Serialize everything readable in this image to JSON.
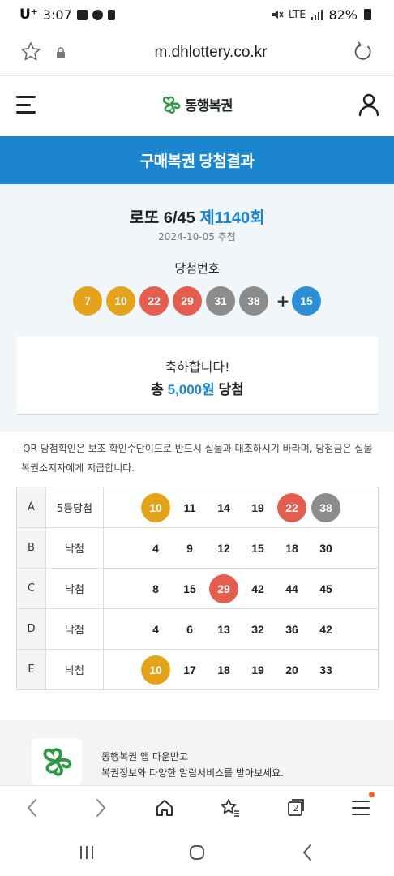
{
  "status_bar": {
    "carrier": "U⁺",
    "time": "3:07",
    "network": "LTE",
    "battery": "82%"
  },
  "browser": {
    "url": "m.dhlottery.co.kr",
    "tabs_count": "2"
  },
  "site": {
    "logo_text": "동행복권",
    "page_title": "구매복권 당첨결과"
  },
  "draw": {
    "game": "로또 6/45",
    "round": "제1140회",
    "date": "2024-10-05 추첨",
    "winning_label": "당첨번호",
    "numbers": [
      7,
      10,
      22,
      29,
      31,
      38
    ],
    "bonus": 15,
    "ball_colors": {
      "7": "#e5a31c",
      "10": "#e5a31c",
      "22": "#e45d4f",
      "29": "#e45d4f",
      "31": "#8c8c8c",
      "38": "#8c8c8c",
      "15": "#2a8fd6"
    }
  },
  "result": {
    "congrats": "축하합니다!",
    "total_prefix": "총",
    "total_amount": "5,000원",
    "total_suffix": "당첨"
  },
  "notice": {
    "line1": "- QR 당첨확인은 보조 확인수단이므로 반드시 실물과 대조하시기 바라며, 당첨금은 실물",
    "line2": "복권소지자에게 지급합니다."
  },
  "tickets": [
    {
      "letter": "A",
      "status": "5등당첨",
      "numbers": [
        "10",
        "11",
        "14",
        "19",
        "22",
        "38"
      ],
      "hits": [
        true,
        false,
        false,
        false,
        true,
        true
      ]
    },
    {
      "letter": "B",
      "status": "낙첨",
      "numbers": [
        "4",
        "9",
        "12",
        "15",
        "18",
        "30"
      ],
      "hits": [
        false,
        false,
        false,
        false,
        false,
        false
      ]
    },
    {
      "letter": "C",
      "status": "낙첨",
      "numbers": [
        "8",
        "15",
        "29",
        "42",
        "44",
        "45"
      ],
      "hits": [
        false,
        false,
        true,
        false,
        false,
        false
      ]
    },
    {
      "letter": "D",
      "status": "낙첨",
      "numbers": [
        "4",
        "6",
        "13",
        "32",
        "36",
        "42"
      ],
      "hits": [
        false,
        false,
        false,
        false,
        false,
        false
      ]
    },
    {
      "letter": "E",
      "status": "낙첨",
      "numbers": [
        "10",
        "17",
        "18",
        "19",
        "20",
        "33"
      ],
      "hits": [
        true,
        false,
        false,
        false,
        false,
        false
      ]
    }
  ],
  "promo": {
    "line1": "동행복권 앱 다운받고",
    "line2": "복권정보와 다양한 알림서비스를 받아보세요."
  },
  "colors": {
    "accent": "#1b86cf",
    "logo_green": "#2e9a46",
    "notification": "#f26522"
  },
  "icons": [
    "favorite-star-icon",
    "lock-icon",
    "reload-icon",
    "hamburger-menu-icon",
    "user-icon",
    "back-icon",
    "forward-icon",
    "home-icon",
    "bookmarks-icon",
    "tabs-icon",
    "browser-menu-icon",
    "recent-apps-icon",
    "home-nav-icon",
    "back-nav-icon"
  ]
}
